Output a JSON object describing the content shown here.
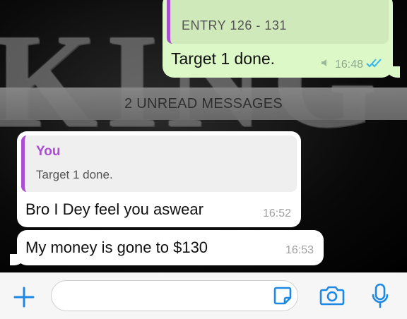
{
  "outgoing": {
    "quote_text": "ENTRY 126 - 131",
    "text": "Target 1 done.",
    "time": "16:48",
    "status_icon": "double-check-icon",
    "muted_icon": "speaker-icon"
  },
  "unread_banner": {
    "text": "2 UNREAD MESSAGES"
  },
  "incoming": [
    {
      "quote_author": "You",
      "quote_text": "Target 1 done.",
      "text": "Bro I Dey feel you aswear",
      "time": "16:52"
    },
    {
      "text": "My money is gone to $130",
      "time": "16:53"
    }
  ],
  "input_bar": {
    "placeholder": "",
    "icons": [
      "plus-icon",
      "sticker-icon",
      "camera-icon",
      "microphone-icon"
    ]
  },
  "colors": {
    "accent": "#1e88e5",
    "outgoing_bubble": "#dcf8c6",
    "quote_bar": "#a94fd0",
    "read_ticks": "#34b7f1"
  }
}
